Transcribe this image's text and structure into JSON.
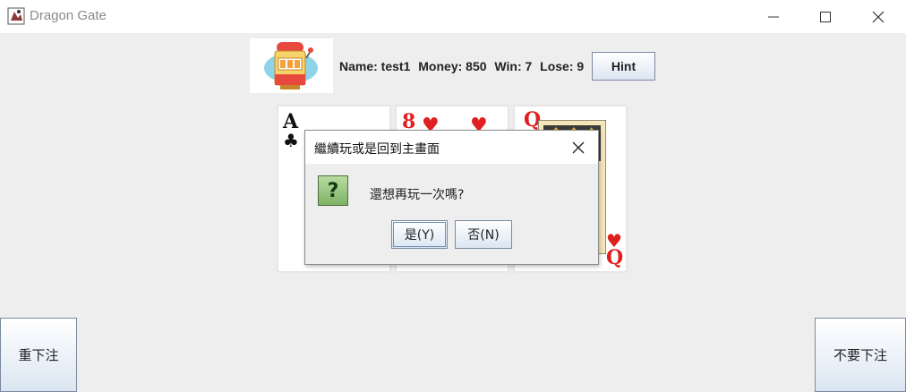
{
  "window": {
    "title": "Dragon Gate",
    "minimize_icon": "minimize-icon",
    "maximize_icon": "maximize-icon",
    "close_icon": "close-icon"
  },
  "player": {
    "name_label": "Name: test1",
    "money_label": "Money: 850",
    "win_label": "Win: 7",
    "lose_label": "Lose: 9"
  },
  "toolbar": {
    "hint_label": "Hint"
  },
  "cards": [
    {
      "rank": "A",
      "suit": "♣",
      "color": "#111111"
    },
    {
      "rank": "8",
      "suit": "♥",
      "color": "#e02020"
    },
    {
      "rank": "Q",
      "suit": "♥",
      "color": "#e02020"
    }
  ],
  "dialog": {
    "title": "繼續玩或是回到主畫面",
    "message": "還想再玩一次嗎?",
    "yes_label": "是(Y)",
    "no_label": "否(N)",
    "icon": "question-icon"
  },
  "actions": {
    "rebet_label": "重下注",
    "nobet_label": "不要下注"
  },
  "colors": {
    "background": "#eeeeee",
    "button_gradient_bottom": "#dbe6f2",
    "heart_red": "#e02020"
  }
}
